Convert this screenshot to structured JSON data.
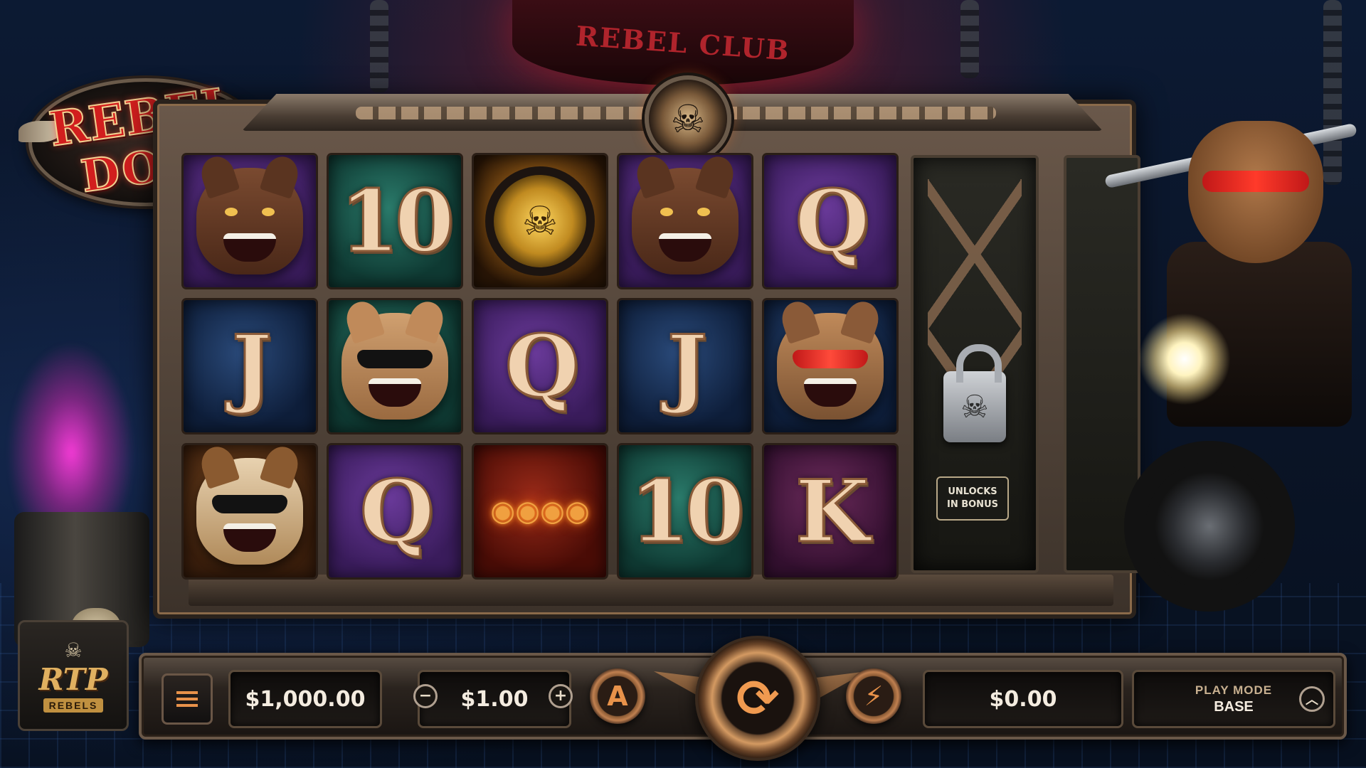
{
  "background": {
    "banner_text": "REBEL CLUB"
  },
  "logo": {
    "line1": "REBEL",
    "line2": "DOG"
  },
  "reels": {
    "cells": [
      {
        "symbol": "",
        "icon": "pitbull-icon",
        "bg": "purple"
      },
      {
        "symbol": "10",
        "icon": "ten-icon",
        "bg": "green"
      },
      {
        "symbol": "",
        "icon": "collar-icon",
        "bg": "gold"
      },
      {
        "symbol": "",
        "icon": "pitbull-icon",
        "bg": "purple"
      },
      {
        "symbol": "Q",
        "icon": "queen-icon",
        "bg": "purple"
      },
      {
        "symbol": "J",
        "icon": "jack-icon",
        "bg": "blue"
      },
      {
        "symbol": "",
        "icon": "frenchie-icon",
        "bg": "green"
      },
      {
        "symbol": "Q",
        "icon": "queen-icon",
        "bg": "purple"
      },
      {
        "symbol": "J",
        "icon": "jack-icon",
        "bg": "blue"
      },
      {
        "symbol": "",
        "icon": "biker-dog-icon",
        "bg": "blue"
      },
      {
        "symbol": "",
        "icon": "bulldog-icon",
        "bg": "orange"
      },
      {
        "symbol": "Q",
        "icon": "queen-icon",
        "bg": "purple"
      },
      {
        "symbol": "",
        "icon": "brass-knuckles-icon",
        "bg": "red"
      },
      {
        "symbol": "10",
        "icon": "ten-icon",
        "bg": "green"
      },
      {
        "symbol": "K",
        "icon": "king-icon",
        "bg": "plum"
      }
    ],
    "locked_reel_label_line1": "UNLOCKS",
    "locked_reel_label_line2": "IN BONUS"
  },
  "brand": {
    "name": "RTP",
    "subtitle": "REBELS"
  },
  "console": {
    "balance": "$1,000.00",
    "bet": "$1.00",
    "decrease_label": "−",
    "increase_label": "+",
    "autoplay_label": "A",
    "turbo_label": "⚡",
    "spin_label": "⟳",
    "win": "$0.00",
    "play_mode_label": "PLAY MODE",
    "play_mode_value": "BASE",
    "expand_label": "︿"
  },
  "colors": {
    "accent": "#e8924a",
    "frame": "#6a584a",
    "text": "#f4ece0"
  }
}
